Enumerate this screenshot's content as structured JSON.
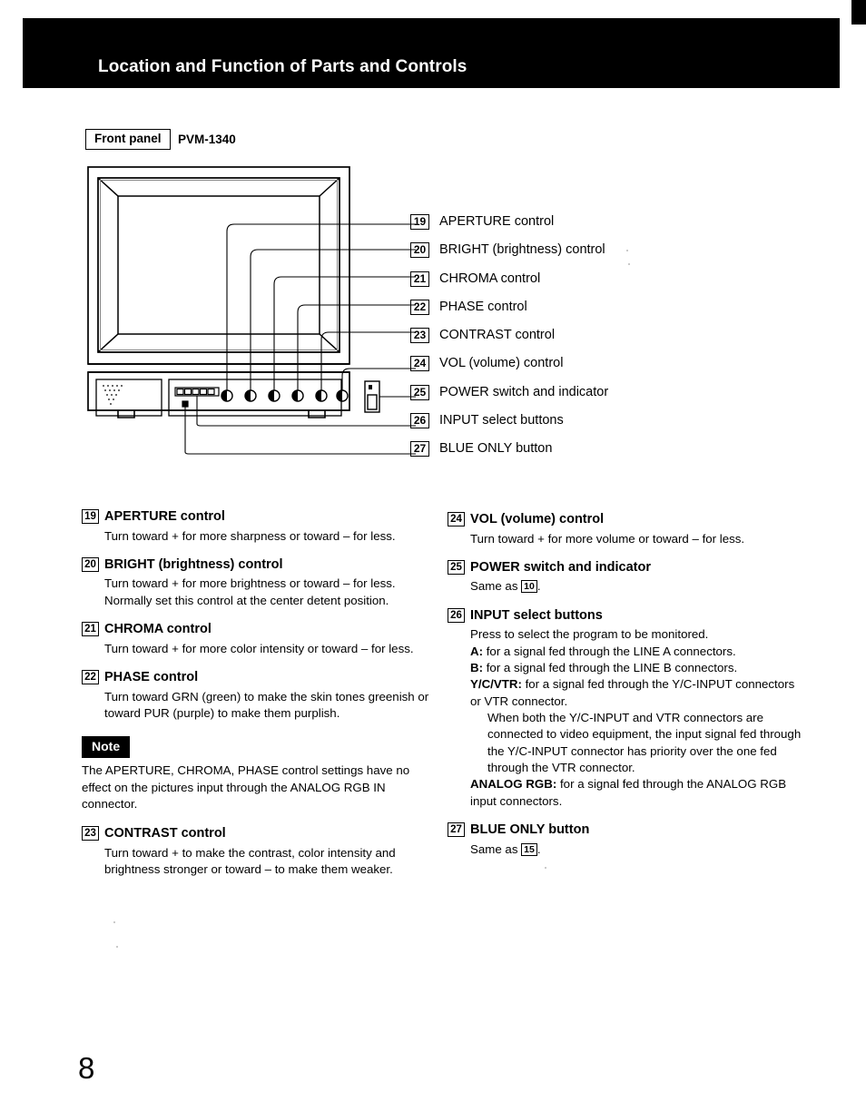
{
  "header": {
    "title": "Location and Function of Parts and Controls"
  },
  "front_panel": {
    "box_label": "Front panel",
    "model": "PVM-1340"
  },
  "callouts": [
    {
      "num": "19",
      "label": "APERTURE control"
    },
    {
      "num": "20",
      "label": "BRIGHT (brightness) control"
    },
    {
      "num": "21",
      "label": "CHROMA control"
    },
    {
      "num": "22",
      "label": "PHASE control"
    },
    {
      "num": "23",
      "label": "CONTRAST control"
    },
    {
      "num": "24",
      "label": "VOL (volume) control"
    },
    {
      "num": "25",
      "label": "POWER switch and indicator"
    },
    {
      "num": "26",
      "label": "INPUT select buttons"
    },
    {
      "num": "27",
      "label": "BLUE ONLY button"
    }
  ],
  "left_column": {
    "aperture": {
      "num": "19",
      "title": "APERTURE control",
      "body": "Turn toward + for more sharpness or toward – for less."
    },
    "bright": {
      "num": "20",
      "title": "BRIGHT (brightness) control",
      "body_line1": "Turn toward + for more brightness or toward – for less.",
      "body_line2": "Normally set this control at the center detent position."
    },
    "chroma": {
      "num": "21",
      "title": "CHROMA control",
      "body": "Turn toward + for more color intensity or toward – for less."
    },
    "phase": {
      "num": "22",
      "title": "PHASE control",
      "body": "Turn toward GRN (green) to make the skin tones greenish or toward PUR (purple) to make them purplish."
    },
    "note": {
      "badge": "Note",
      "text": "The APERTURE, CHROMA, PHASE control settings have no effect on the pictures input through the ANALOG RGB IN connector."
    },
    "contrast": {
      "num": "23",
      "title": "CONTRAST control",
      "body": "Turn toward + to make the contrast, color intensity and brightness stronger or toward – to make them weaker."
    }
  },
  "right_column": {
    "vol": {
      "num": "24",
      "title": "VOL (volume) control",
      "body": "Turn toward + for more volume or toward – for less."
    },
    "power": {
      "num": "25",
      "title": "POWER switch and indicator",
      "body_prefix": "Same as ",
      "body_ref": "10",
      "body_suffix": "."
    },
    "input": {
      "num": "26",
      "title": "INPUT select buttons",
      "intro": "Press to select the program to be monitored.",
      "a_label": "A:",
      "a_text": " for a signal fed through the LINE A connectors.",
      "b_label": "B:",
      "b_text": " for a signal fed through the LINE B connectors.",
      "yc_label": "Y/C/VTR:",
      "yc_text": " for a signal fed through the Y/C-INPUT connectors or VTR connector.",
      "yc_note": "When both the Y/C-INPUT and VTR connectors are connected to video equipment, the input signal fed through the Y/C-INPUT connector has priority over the one fed through the VTR connector.",
      "rgb_label": "ANALOG RGB:",
      "rgb_text": " for a signal fed through the ANALOG RGB input connectors."
    },
    "blue_only": {
      "num": "27",
      "title": "BLUE ONLY button",
      "body_prefix": "Same as ",
      "body_ref": "15",
      "body_suffix": "."
    }
  },
  "page": {
    "number": "8"
  }
}
